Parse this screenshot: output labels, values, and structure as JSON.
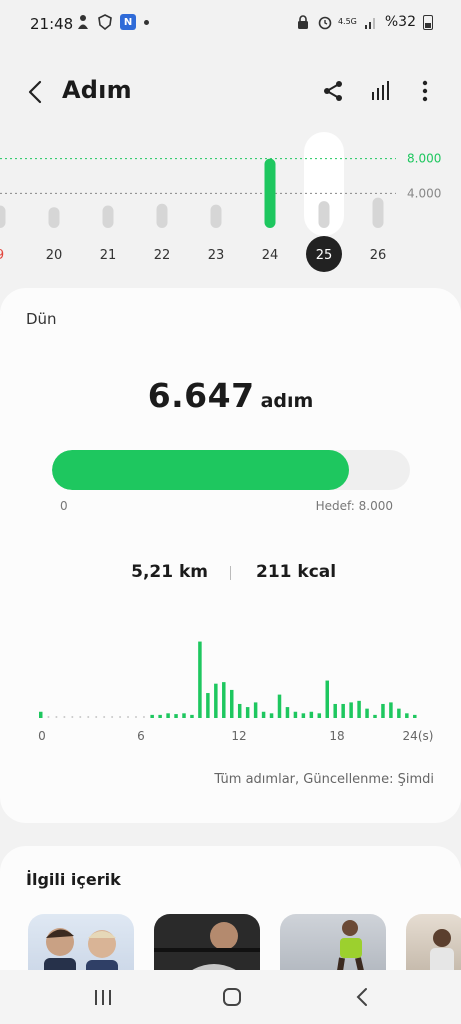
{
  "status": {
    "time": "21:48",
    "network_small": "4.5G",
    "battery": "%32"
  },
  "header": {
    "title": "Adım"
  },
  "weekly": {
    "days": [
      {
        "label": "9",
        "value": 2600,
        "highlight_color": "#e2453c"
      },
      {
        "label": "20",
        "value": 2400
      },
      {
        "label": "21",
        "value": 2600
      },
      {
        "label": "22",
        "value": 2800
      },
      {
        "label": "23",
        "value": 2700
      },
      {
        "label": "24",
        "value": 8000
      },
      {
        "label": "25",
        "value": 3100,
        "selected": true
      },
      {
        "label": "26",
        "value": 3500
      }
    ],
    "ticks": [
      {
        "label": "8.000",
        "value": 8000,
        "color": "#1ec75f"
      },
      {
        "label": "4.000",
        "value": 4000,
        "color": "#888888"
      }
    ],
    "goal_color": "#1ec75f",
    "max": 9000
  },
  "card": {
    "day_label": "Dün",
    "steps": "6.647",
    "steps_unit": "adım",
    "progress": 0.831,
    "progress_min": "0",
    "goal_label": "Hedef: 8.000",
    "distance": "5,21 km",
    "calories": "211 kcal",
    "updated": "Tüm adımlar, Güncellenme: Şimdi"
  },
  "chart_data": {
    "type": "bar",
    "x": [
      0,
      1,
      2,
      3,
      4,
      5,
      6,
      7,
      8,
      9,
      10,
      11,
      12,
      13,
      14,
      15,
      16,
      17,
      18,
      19,
      20,
      21,
      22,
      23
    ],
    "xticks": [
      "0",
      "6",
      "12",
      "18",
      "24(s)"
    ],
    "values": [
      40,
      0,
      0,
      0,
      0,
      0,
      0,
      20,
      20,
      15,
      490,
      190,
      180,
      120,
      100,
      150,
      40,
      240,
      90,
      110,
      90,
      100,
      30,
      20
    ],
    "half_hour_values": [
      40,
      8,
      5,
      5,
      5,
      5,
      5,
      5,
      5,
      5,
      5,
      5,
      5,
      5,
      20,
      20,
      30,
      25,
      30,
      20,
      490,
      160,
      220,
      230,
      180,
      90,
      70,
      100,
      40,
      30,
      150,
      70,
      40,
      30,
      40,
      30,
      240,
      90,
      90,
      100,
      110,
      60,
      20,
      90,
      100,
      60,
      30,
      20
    ],
    "color": "#1ec75f"
  },
  "related": {
    "title": "İlgili içerik"
  }
}
